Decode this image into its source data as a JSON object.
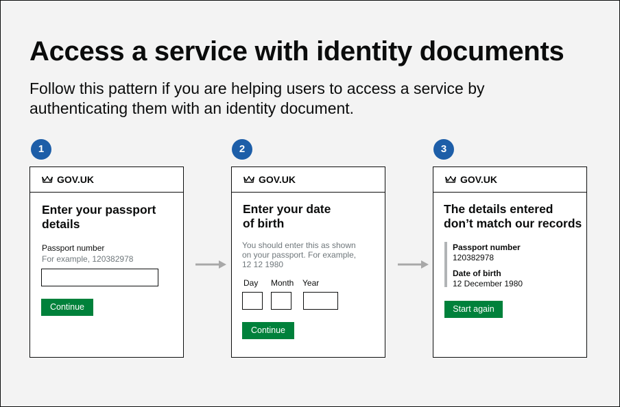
{
  "title": "Access a service with identity documents",
  "subtitle": "Follow this pattern if you are helping users to access a service by authenticating them with an identity document.",
  "steps": [
    {
      "number": "1",
      "brand": "GOV.UK",
      "heading_line1": "Enter your passport",
      "heading_line2": "details",
      "field_label": "Passport number",
      "field_hint": "For example, 120382978",
      "button_label": "Continue"
    },
    {
      "number": "2",
      "brand": "GOV.UK",
      "heading_line1": "Enter your date",
      "heading_line2": "of birth",
      "hint_line1": "You should enter this as shown",
      "hint_line2": "on your passport. For example,",
      "hint_line3": "12 12 1980",
      "day_label": "Day",
      "month_label": "Month",
      "year_label": "Year",
      "button_label": "Continue"
    },
    {
      "number": "3",
      "brand": "GOV.UK",
      "heading_line1": "The details entered",
      "heading_line2": "don’t match our records",
      "passport_label": "Passport number",
      "passport_value": "120382978",
      "dob_label": "Date of birth",
      "dob_value": "12 December 1980",
      "button_label": "Start again"
    }
  ],
  "colors": {
    "step_badge": "#1d5ea8",
    "button": "#00813b",
    "arrow": "#a8a8a8",
    "background": "#f3f3f3"
  }
}
